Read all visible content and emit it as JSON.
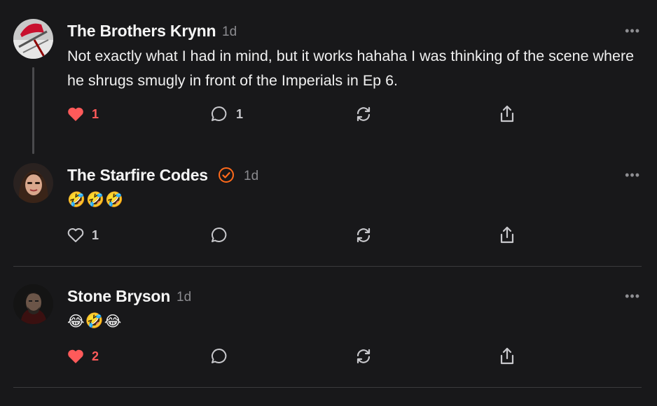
{
  "comments": [
    {
      "author": "The Brothers Krynn",
      "time": "1d",
      "verified": false,
      "avatar_icon": "red-helmet-avatar",
      "body": "Not exactly what I had in mind, but it works hahaha I was thinking of the scene where he shrugs smugly in front of the Imperials in Ep 6.",
      "liked": true,
      "likes": "1",
      "replies": "1",
      "more_label": "•••"
    },
    {
      "author": "The Starfire Codes",
      "time": "1d",
      "verified": true,
      "avatar_icon": "woman-portrait-avatar",
      "emojis": [
        "🤣",
        "🤣",
        "🤣"
      ],
      "liked": false,
      "likes": "1",
      "replies": "",
      "more_label": "•••"
    },
    {
      "author": "Stone Bryson",
      "time": "1d",
      "verified": false,
      "avatar_icon": "dark-portrait-avatar",
      "emojis": [
        "😂",
        "🤣",
        "😂"
      ],
      "liked": true,
      "likes": "2",
      "replies": "",
      "more_label": "•••"
    }
  ],
  "colors": {
    "background": "#18181a",
    "liked": "#ff5a5a",
    "icon": "#c8c8cc",
    "verified": "#ff6a1a",
    "muted": "#8a8a8e"
  }
}
